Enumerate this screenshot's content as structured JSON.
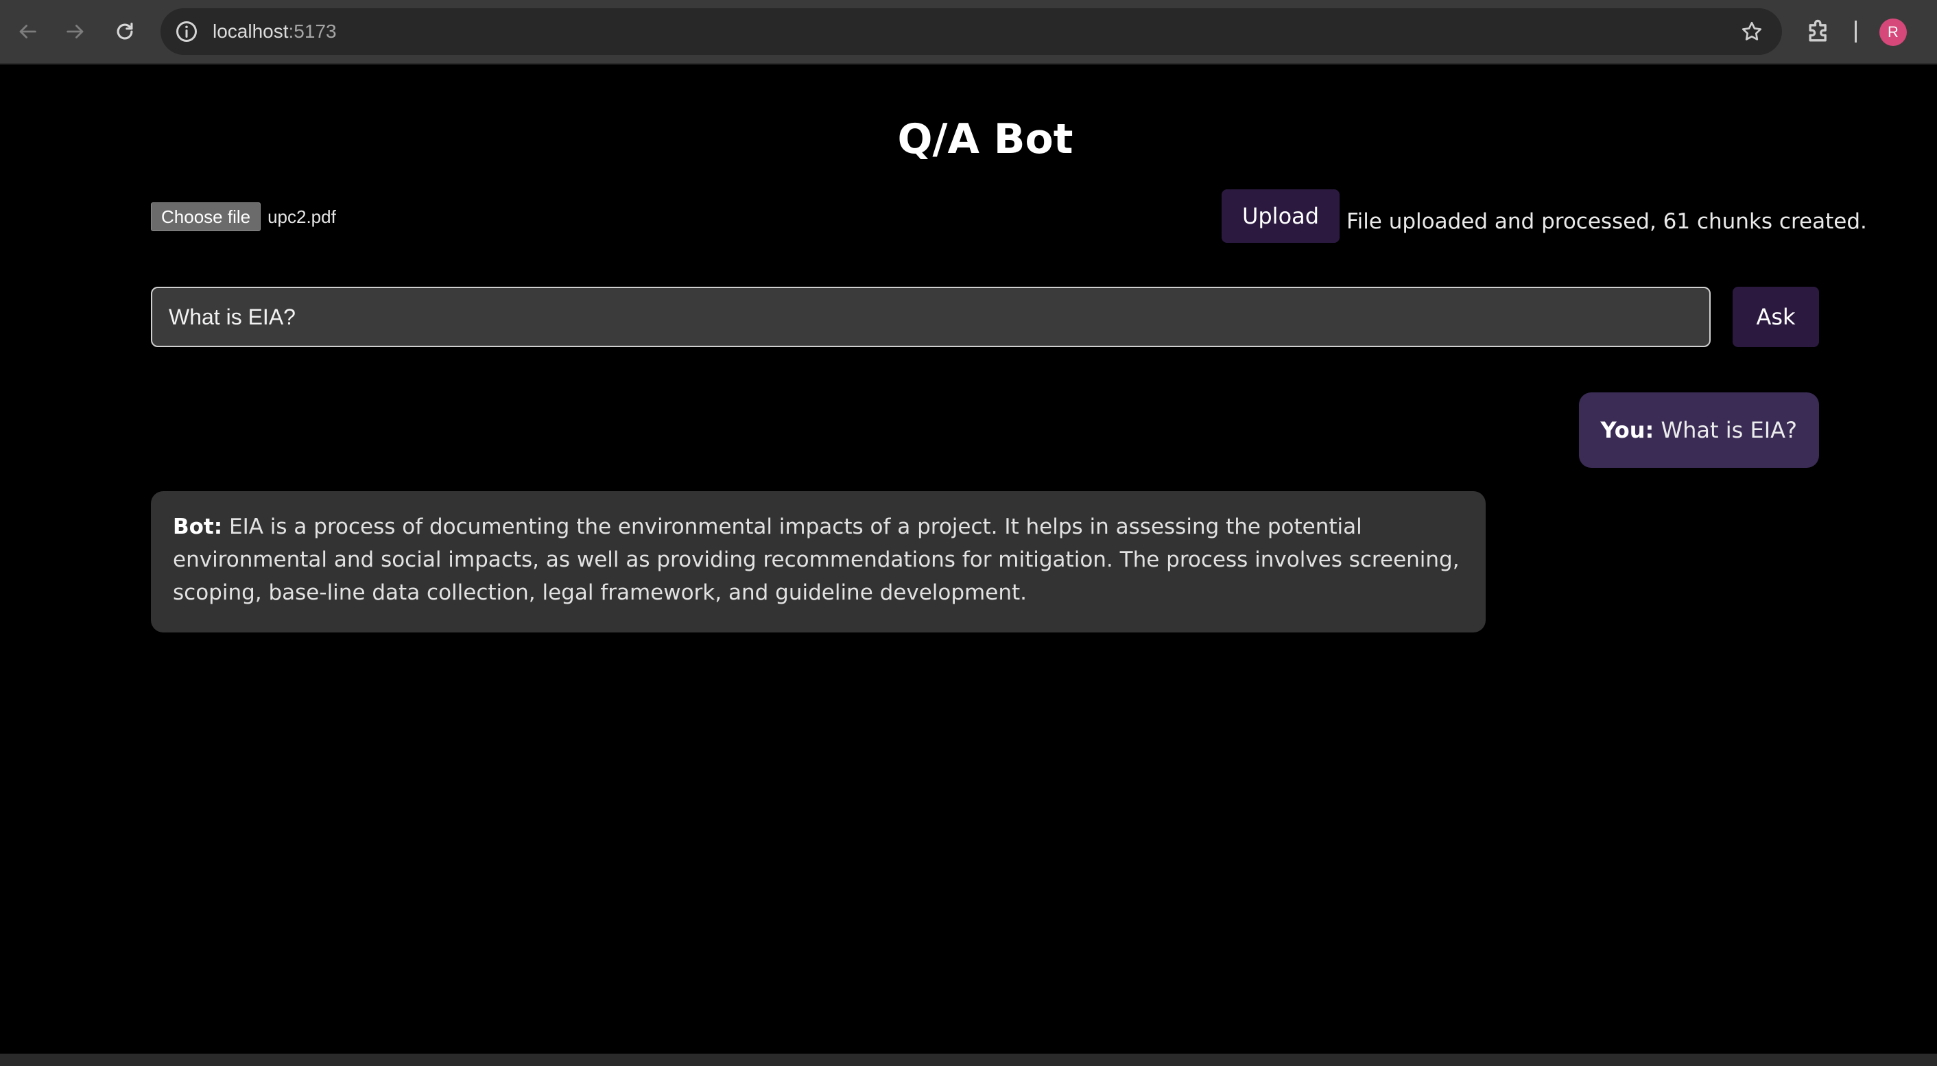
{
  "browser": {
    "url_host": "localhost",
    "url_port": ":5173",
    "profile_initial": "R",
    "icons": [
      "back-icon",
      "forward-icon",
      "reload-icon",
      "site-info-icon",
      "star-icon",
      "extensions-icon"
    ]
  },
  "app": {
    "title": "Q/A Bot",
    "file_picker": {
      "button_label": "Choose file",
      "selected_file": "upc2.pdf"
    },
    "upload_label": "Upload",
    "upload_status": "File uploaded and processed, 61 chunks created.",
    "question_input": {
      "value": "What is EIA?"
    },
    "ask_label": "Ask"
  },
  "conversation": [
    {
      "speaker": "You:",
      "text": "What is EIA?"
    },
    {
      "speaker": "Bot:",
      "text": "EIA is a process of documenting the environmental impacts of a project. It helps in assessing the potential environmental and social impacts, as well as providing recommendations for mitigation. The process involves screening, scoping, base-line data collection, legal framework, and guideline development."
    }
  ],
  "colors": {
    "background": "#000000",
    "button_bg": "#2b1940",
    "user_bubble": "#3a2c55",
    "bot_bubble": "#333333",
    "avatar": "#d6487a"
  }
}
